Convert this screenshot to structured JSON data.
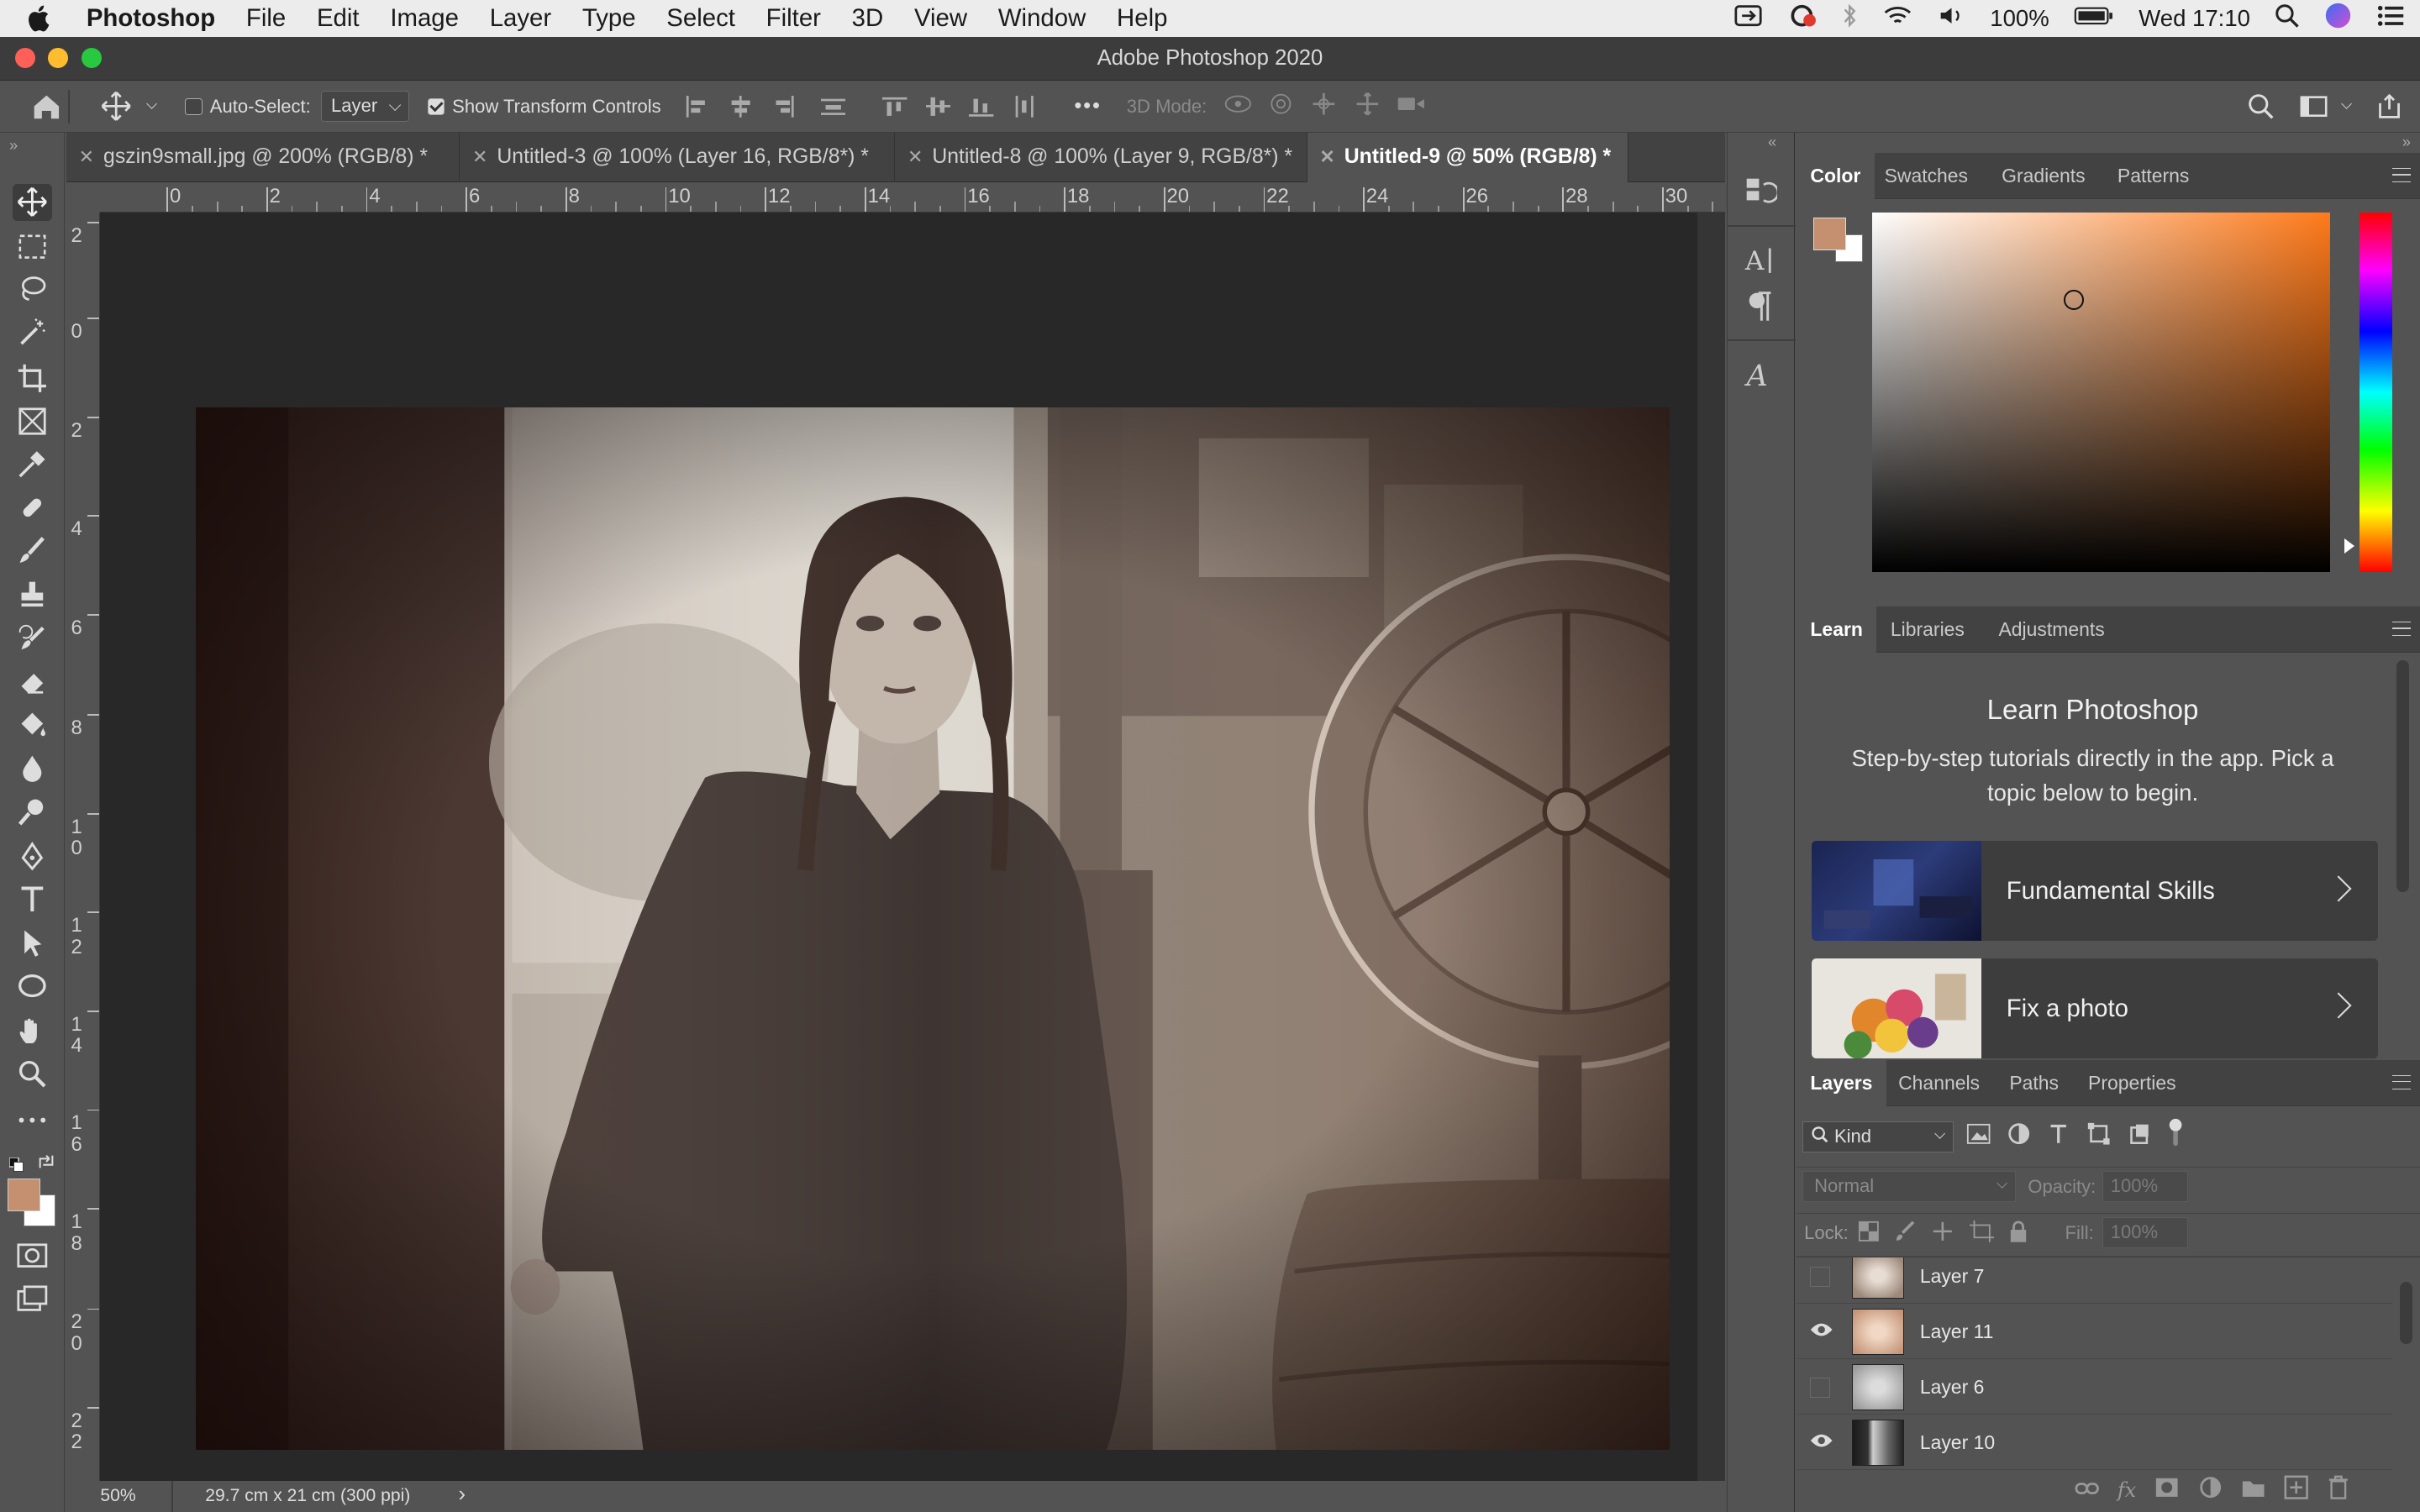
{
  "menubar": {
    "apple_icon": "apple-logo",
    "app_name": "Photoshop",
    "items": [
      "File",
      "Edit",
      "Image",
      "Layer",
      "Type",
      "Select",
      "Filter",
      "3D",
      "View",
      "Window",
      "Help"
    ],
    "battery": "100%",
    "clock": "Wed 17:10"
  },
  "window": {
    "title": "Adobe Photoshop 2020",
    "close_color": "#fe5f57",
    "min_color": "#febc2e",
    "max_color": "#28c840"
  },
  "options_bar": {
    "auto_select_label": "Auto-Select:",
    "auto_select_checked": false,
    "auto_select_value": "Layer",
    "show_transform_label": "Show Transform Controls",
    "show_transform_checked": true,
    "more_label": "•••",
    "mode_3d_label": "3D Mode:"
  },
  "tabs": [
    {
      "label": "gszin9small.jpg @ 200% (RGB/8) *",
      "active": false
    },
    {
      "label": "Untitled-3 @ 100% (Layer 16, RGB/8*) *",
      "active": false
    },
    {
      "label": "Untitled-8 @ 100% (Layer 9, RGB/8*) *",
      "active": false
    },
    {
      "label": "Untitled-9 @ 50% (RGB/8) *",
      "active": true
    }
  ],
  "ruler": {
    "horizontal": [
      "0",
      "2",
      "4",
      "6",
      "8",
      "10",
      "12",
      "14",
      "16",
      "18",
      "20",
      "22",
      "24",
      "26",
      "28",
      "30"
    ],
    "vertical": [
      "2",
      "0",
      "2",
      "4",
      "6",
      "8",
      "1\n0",
      "1\n2",
      "1\n4",
      "1\n6",
      "1\n8",
      "2\n0",
      "2\n2"
    ]
  },
  "status": {
    "zoom": "50%",
    "doc_size": "29.7 cm x 21 cm (300 ppi)",
    "arrow": "›"
  },
  "colors": {
    "foreground": "#c4906f",
    "background": "#ffffff",
    "picker_hue": "#ff7a1a",
    "accent": "#ffffff"
  },
  "color_panel": {
    "tabs": [
      "Color",
      "Swatches",
      "Gradients",
      "Patterns"
    ],
    "active_tab": "Color"
  },
  "learn_panel": {
    "tabs": [
      "Learn",
      "Libraries",
      "Adjustments"
    ],
    "active_tab": "Learn",
    "heading": "Learn Photoshop",
    "description": "Step-by-step tutorials directly in the app. Pick a topic below to begin.",
    "cards": [
      {
        "label": "Fundamental Skills"
      },
      {
        "label": "Fix a photo"
      }
    ]
  },
  "layers_panel": {
    "tabs": [
      "Layers",
      "Channels",
      "Paths",
      "Properties"
    ],
    "active_tab": "Layers",
    "filter_label": "Kind",
    "blend_mode": "Normal",
    "opacity_label": "Opacity:",
    "opacity_value": "100%",
    "lock_label": "Lock:",
    "fill_label": "Fill:",
    "fill_value": "100%",
    "layers": [
      {
        "name": "Layer 7",
        "visible": false
      },
      {
        "name": "Layer 11",
        "visible": true
      },
      {
        "name": "Layer 6",
        "visible": false
      },
      {
        "name": "Layer 10",
        "visible": true
      }
    ]
  }
}
